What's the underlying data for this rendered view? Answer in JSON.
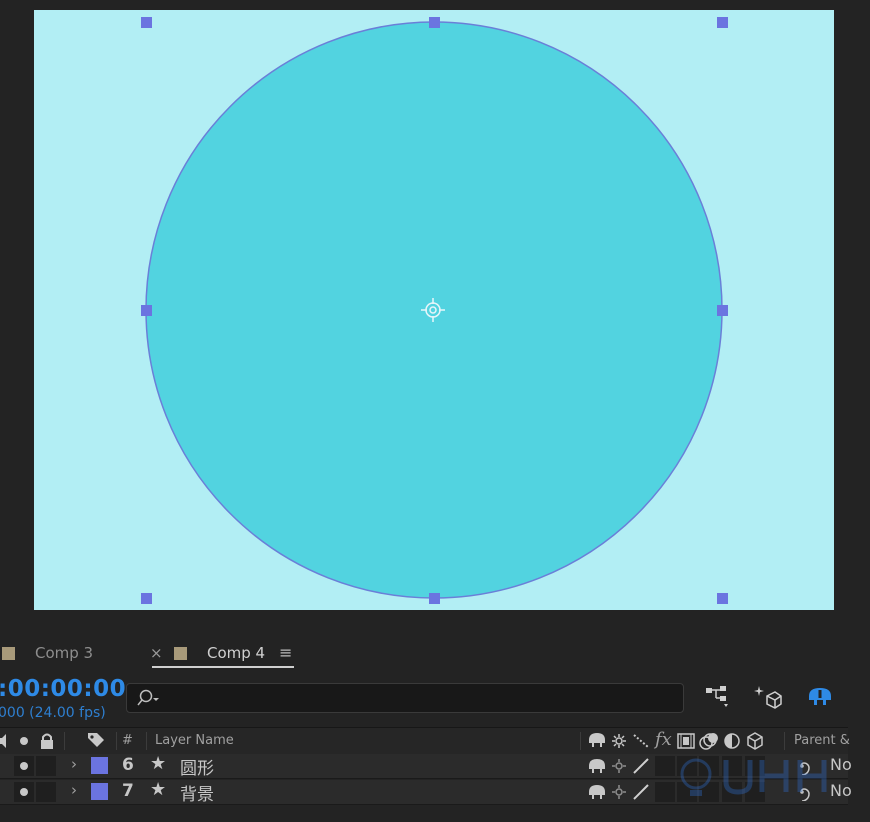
{
  "viewer": {
    "canvas_color": "#b2eef4",
    "shape_color": "#52d3e0",
    "shape_stroke": "#6a7fd8",
    "handle_color": "#6b74e0"
  },
  "tabs": [
    {
      "label": "Comp 3",
      "swatch_color": "#a89a7a",
      "active": false
    },
    {
      "label": "Comp 4",
      "swatch_color": "#a89a7a",
      "active": true
    }
  ],
  "tab_close_glyph": "×",
  "tab_menu_glyph": "≡",
  "timeline": {
    "timecode": ":00:00:00",
    "fps_text": "000 (24.00 fps)",
    "search_placeholder": ""
  },
  "columns": {
    "number": "#",
    "layer_name": "Layer Name",
    "parent": "Parent &"
  },
  "layers": [
    {
      "number": "6",
      "name": "圆形",
      "label_color": "#6b74e0",
      "parent": "No"
    },
    {
      "number": "7",
      "name": "背景",
      "label_color": "#6b74e0",
      "parent": "No"
    }
  ],
  "icons": {
    "accent_blue": "#2e8ae6"
  }
}
